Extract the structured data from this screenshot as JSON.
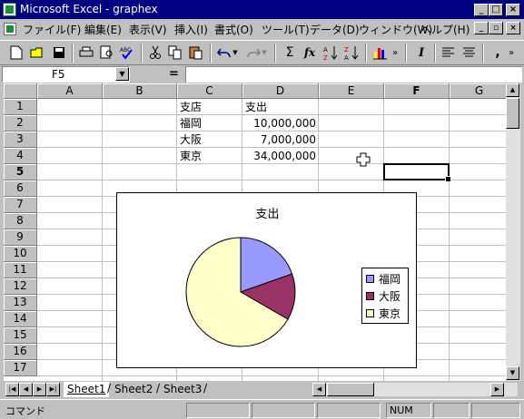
{
  "window": {
    "title": "Microsoft Excel - graphex",
    "buttons": {
      "minimize": "_",
      "maximize": "□",
      "close": "×"
    }
  },
  "menu": {
    "items": [
      "ファイル(F)",
      "編集(E)",
      "表示(V)",
      "挿入(I)",
      "書式(O)",
      "ツール(T)",
      "データ(D)",
      "ウィンドウ(W)",
      "ヘルプ(H)"
    ]
  },
  "toolbar": {
    "sum": "Σ",
    "fx": "fx",
    "italic": "I",
    "comma": ","
  },
  "formula_bar": {
    "name_box": "F5",
    "equals": "=",
    "value": ""
  },
  "grid": {
    "columns": [
      "A",
      "B",
      "C",
      "D",
      "E",
      "F",
      "G"
    ],
    "rows": [
      "1",
      "2",
      "3",
      "4",
      "5",
      "6",
      "7",
      "8",
      "9",
      "10",
      "11",
      "12",
      "13",
      "14",
      "15",
      "16",
      "17"
    ],
    "selected_column": "F",
    "selected_row": "5",
    "cells": {
      "C1": "支店",
      "D1": "支出",
      "C2": "福岡",
      "D2": "10,000,000",
      "C3": "大阪",
      "D3": "7,000,000",
      "C4": "東京",
      "D4": "34,000,000"
    }
  },
  "chart_data": {
    "type": "pie",
    "title": "支出",
    "categories": [
      "福岡",
      "大阪",
      "東京"
    ],
    "values": [
      10000000,
      7000000,
      34000000
    ],
    "colors": [
      "#9999ff",
      "#993366",
      "#ffffcc"
    ],
    "legend_position": "right"
  },
  "sheets": {
    "tabs": [
      "Sheet1",
      "Sheet2",
      "Sheet3"
    ],
    "active": "Sheet1"
  },
  "status": {
    "text": "コマンド",
    "num": "NUM"
  }
}
